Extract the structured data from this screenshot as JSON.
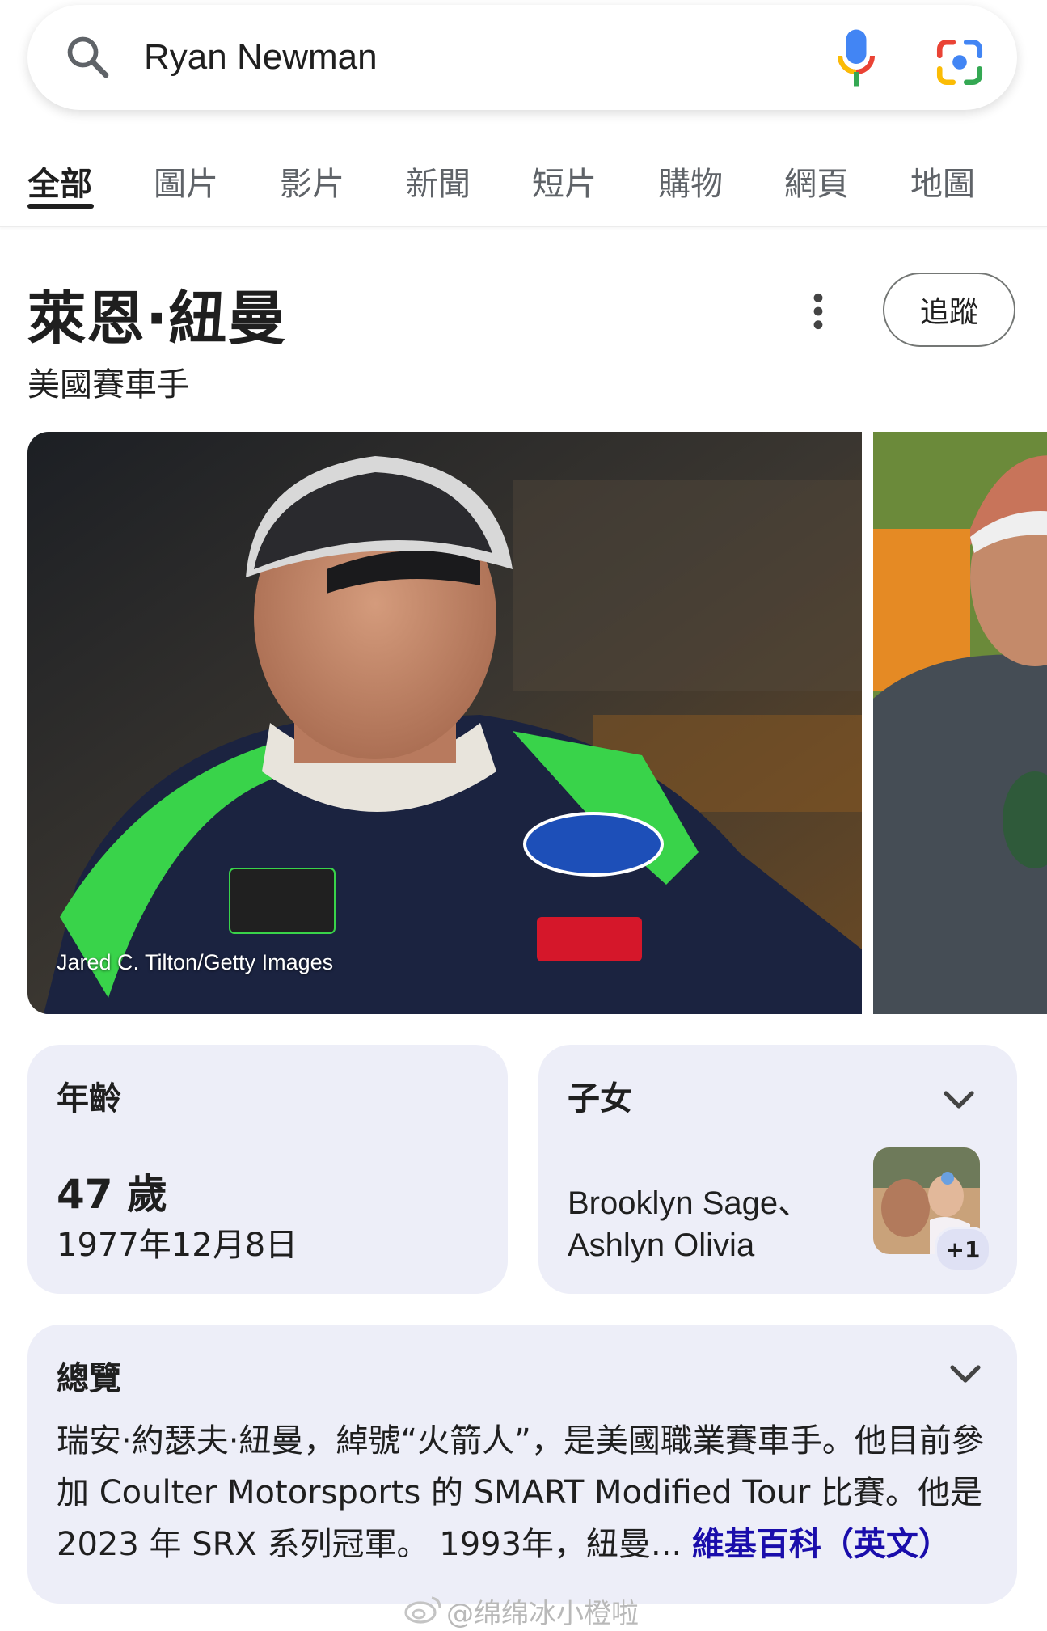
{
  "search": {
    "query": "Ryan Newman"
  },
  "tabs": [
    {
      "label": "全部",
      "active": true
    },
    {
      "label": "圖片"
    },
    {
      "label": "影片"
    },
    {
      "label": "新聞"
    },
    {
      "label": "短片"
    },
    {
      "label": "購物"
    },
    {
      "label": "網頁"
    },
    {
      "label": "地圖"
    }
  ],
  "knowledge_panel": {
    "title": "萊恩·紐曼",
    "subtitle": "美國賽車手",
    "follow_label": "追蹤",
    "photo_credit": "Jared C. Tilton/Getty Images"
  },
  "age_card": {
    "label": "年齡",
    "value": "47 歲",
    "birthdate": "1977年12月8日"
  },
  "children_card": {
    "label": "子女",
    "names": "Brooklyn Sage、Ashlyn Olivia",
    "more_badge": "+1"
  },
  "overview_card": {
    "label": "總覽",
    "text": "瑞安·約瑟夫·紐曼，綽號“火箭人”，是美國職業賽車手。他目前參加 Coulter Motorsports 的 SMART Modified Tour 比賽。他是 2023 年 SRX 系列冠軍。 1993年，紐曼...",
    "source_link": "維基百科（英文）"
  },
  "watermark": "@绵绵冰小橙啦",
  "colors": {
    "card_bg": "#edeef8",
    "link": "#1a0dab",
    "tab_active": "#1f1f1f",
    "tab_inactive": "#5f6368"
  }
}
